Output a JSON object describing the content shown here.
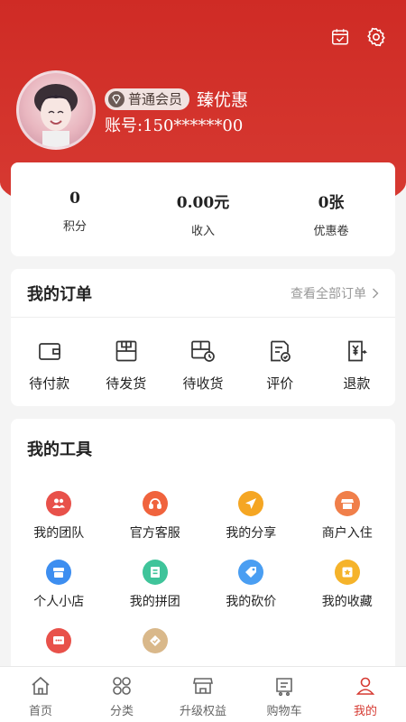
{
  "header": {
    "member_badge": "普通会员",
    "shop_name": "臻优惠",
    "account": "账号:150******00"
  },
  "stats": [
    {
      "value": "0",
      "label": "积分"
    },
    {
      "value": "0.00元",
      "label": "收入"
    },
    {
      "value": "0张",
      "label": "优惠卷"
    }
  ],
  "orders": {
    "title": "我的订单",
    "view_all": "查看全部订单",
    "items": [
      {
        "label": "待付款",
        "icon": "wallet-icon"
      },
      {
        "label": "待发货",
        "icon": "package-icon"
      },
      {
        "label": "待收货",
        "icon": "delivery-icon"
      },
      {
        "label": "评价",
        "icon": "review-icon"
      },
      {
        "label": "退款",
        "icon": "refund-icon"
      }
    ]
  },
  "tools": {
    "title": "我的工具",
    "items": [
      {
        "label": "我的团队",
        "icon": "team-icon",
        "color": "#e8514a"
      },
      {
        "label": "官方客服",
        "icon": "headset-icon",
        "color": "#f0633d"
      },
      {
        "label": "我的分享",
        "icon": "share-icon",
        "color": "#f5a623"
      },
      {
        "label": "商户入住",
        "icon": "store-icon",
        "color": "#f07f4a"
      },
      {
        "label": "个人小店",
        "icon": "shop-icon",
        "color": "#3d8ef0"
      },
      {
        "label": "我的拼团",
        "icon": "group-buy-icon",
        "color": "#3fc49a"
      },
      {
        "label": "我的砍价",
        "icon": "bargain-icon",
        "color": "#4a9ef2"
      },
      {
        "label": "我的收藏",
        "icon": "favorite-icon",
        "color": "#f5b32a"
      },
      {
        "label": "",
        "icon": "message-icon",
        "color": "#e8514a"
      },
      {
        "label": "",
        "icon": "member-icon",
        "color": "#d9b88a"
      }
    ]
  },
  "tabbar": [
    {
      "label": "首页",
      "icon": "home-icon",
      "active": false
    },
    {
      "label": "分类",
      "icon": "category-icon",
      "active": false
    },
    {
      "label": "升级权益",
      "icon": "upgrade-icon",
      "active": false
    },
    {
      "label": "购物车",
      "icon": "cart-icon",
      "active": false
    },
    {
      "label": "我的",
      "icon": "profile-icon",
      "active": true
    }
  ],
  "colors": {
    "brand_red": "#d63a32",
    "badge_bg": "#f1e3e1"
  }
}
